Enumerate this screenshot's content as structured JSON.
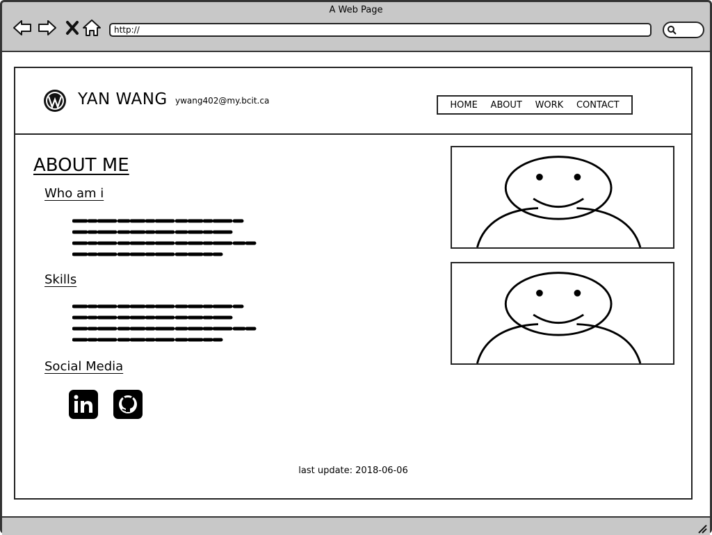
{
  "window": {
    "title": "A Web Page"
  },
  "browser": {
    "url": "http://"
  },
  "header": {
    "site_name": "YAN WANG",
    "email": "ywang402@my.bcit.ca",
    "nav": [
      "HOME",
      "ABOUT",
      "WORK",
      "CONTACT"
    ]
  },
  "main": {
    "title": "ABOUT ME",
    "sections": [
      {
        "title": "Who am i"
      },
      {
        "title": "Skills"
      },
      {
        "title": "Social Media"
      }
    ],
    "social": [
      "linkedin-icon",
      "github-icon"
    ]
  },
  "footer": {
    "last_update": "last update: 2018-06-06"
  }
}
